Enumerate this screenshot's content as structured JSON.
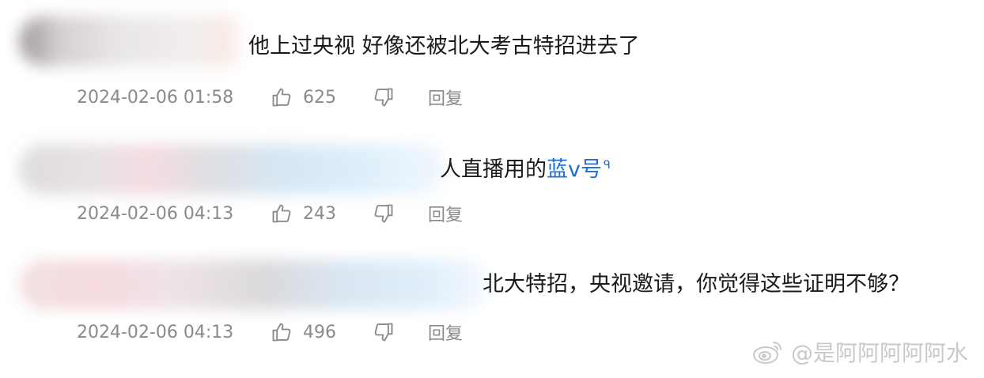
{
  "comments": [
    {
      "text": "他上过央视 好像还被北大考古特招进去了",
      "timestamp": "2024-02-06 01:58",
      "likes": "625",
      "reply_label": "回复"
    },
    {
      "text_before": "人直播用的",
      "link_text": "蓝v号",
      "link_icon": "ᑫ",
      "timestamp": "2024-02-06 04:13",
      "likes": "243",
      "reply_label": "回复"
    },
    {
      "text": "北大特招，央视邀请，你觉得这些证明不够？",
      "timestamp": "2024-02-06 04:13",
      "likes": "496",
      "reply_label": "回复"
    }
  ],
  "watermark": {
    "text": "@是阿阿阿阿阿水",
    "logo": "weibo-logo"
  },
  "colors": {
    "text": "#1a1a1a",
    "meta": "#8a8a8a",
    "link": "#1e6fd6",
    "watermark": "#c9c9c9"
  }
}
